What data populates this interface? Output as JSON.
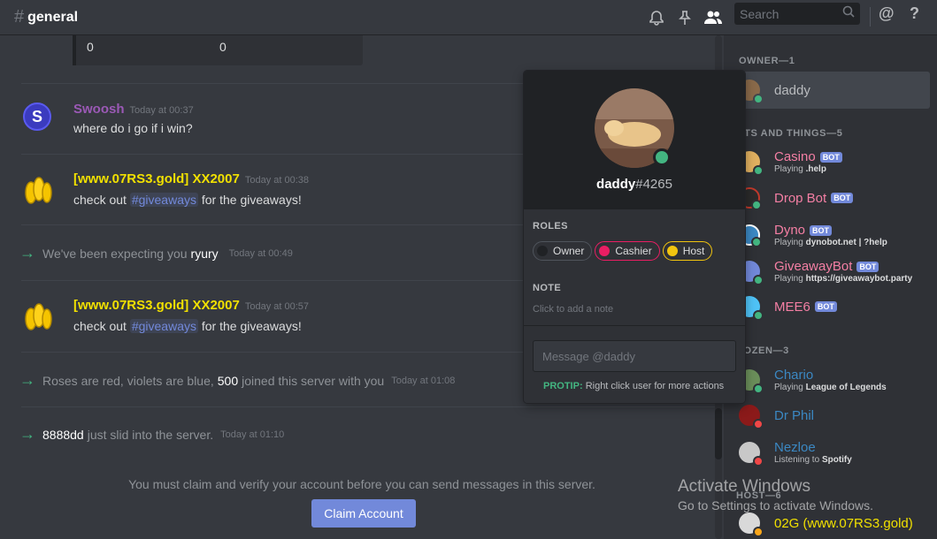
{
  "header": {
    "hash": "#",
    "channel": "general",
    "search_placeholder": "Search",
    "at_symbol": "@",
    "help_symbol": "?",
    "icons": [
      "bell-icon",
      "pin-icon",
      "members-icon",
      "search-icon"
    ]
  },
  "embed": {
    "value1": "0",
    "value2": "0"
  },
  "messages": [
    {
      "author": "Swoosh",
      "author_color": "#9b59b6",
      "time": "Today at 00:37",
      "text": "where do i go if i win?",
      "avatar_letter": "S"
    },
    {
      "author": "[www.07RS3.gold] XX2007",
      "author_color": "#f1e000",
      "time": "Today at 00:38",
      "pre": "check out ",
      "channel": "#giveaways",
      "post": " for the giveaways!"
    },
    {
      "author": "[www.07RS3.gold] XX2007",
      "author_color": "#f1e000",
      "time": "Today at 00:57",
      "pre": "check out ",
      "channel": "#giveaways",
      "post": " for the giveaways!"
    }
  ],
  "system": [
    {
      "pre": "We've been expecting you",
      "bold": "ryury",
      "post": "",
      "time": "Today at 00:49"
    },
    {
      "pre": "Roses are red, violets are blue,",
      "bold": "500",
      "post": "joined this server with you",
      "time": "Today at 01:08"
    },
    {
      "pre": "",
      "bold": "8888dd",
      "post": "just slid into the server.",
      "time": "Today at 01:10"
    }
  ],
  "blocked_notice": "You must claim and verify your account before you can send messages in this server.",
  "claim_button": "Claim Account",
  "members": {
    "groups": [
      {
        "label": "OWNER—1"
      },
      {
        "label": "OTS AND THINGS—5"
      },
      {
        "label": "ROZEN—3"
      },
      {
        "label": "HOST—6"
      }
    ],
    "owner": {
      "name": "daddy",
      "color": "#b9bbbe"
    },
    "bots": [
      {
        "name": "Casino",
        "color": "#f47fa4",
        "badge": "BOT",
        "activity_pre": "Playing",
        "activity": ".help"
      },
      {
        "name": "Drop Bot",
        "color": "#f47fa4",
        "badge": "BOT",
        "activity_pre": "",
        "activity": ""
      },
      {
        "name": "Dyno",
        "color": "#f47fa4",
        "badge": "BOT",
        "activity_pre": "Playing",
        "activity": "dynobot.net | ?help"
      },
      {
        "name": "GiveawayBot",
        "color": "#f47fa4",
        "badge": "BOT",
        "activity_pre": "Playing",
        "activity": "https://giveawaybot.party"
      },
      {
        "name": "MEE6",
        "color": "#f47fa4",
        "badge": "BOT",
        "activity_pre": "",
        "activity": ""
      }
    ],
    "frozen": [
      {
        "name": "Chario",
        "color": "#3b88c3",
        "activity_pre": "Playing",
        "activity": "League of Legends"
      },
      {
        "name": "Dr Phil",
        "color": "#3b88c3",
        "activity_pre": "",
        "activity": ""
      },
      {
        "name": "Nezloe",
        "color": "#3b88c3",
        "activity_pre": "Listening to",
        "activity": "Spotify"
      }
    ],
    "host": [
      {
        "name": "02G (www.07RS3.gold)",
        "color": "#f1e000"
      }
    ]
  },
  "popout": {
    "username": "daddy",
    "discriminator": "#4265",
    "roles_title": "ROLES",
    "roles": [
      {
        "name": "Owner",
        "color": "#202225",
        "border": "#4f545c"
      },
      {
        "name": "Cashier",
        "color": "#e91e63",
        "border": "#e91e63"
      },
      {
        "name": "Host",
        "color": "#f1c40f",
        "border": "#f1c40f"
      }
    ],
    "note_title": "NOTE",
    "note_placeholder": "Click to add a note",
    "message_placeholder": "Message @daddy",
    "protip_label": "PROTIP:",
    "protip_text": "Right click user for more actions"
  },
  "watermark": {
    "line1": "Activate Windows",
    "line2": "Go to Settings to activate Windows."
  },
  "colors": {
    "online": "#43b581",
    "dnd": "#f04747",
    "idle": "#faa61a",
    "blurple": "#7289da"
  }
}
